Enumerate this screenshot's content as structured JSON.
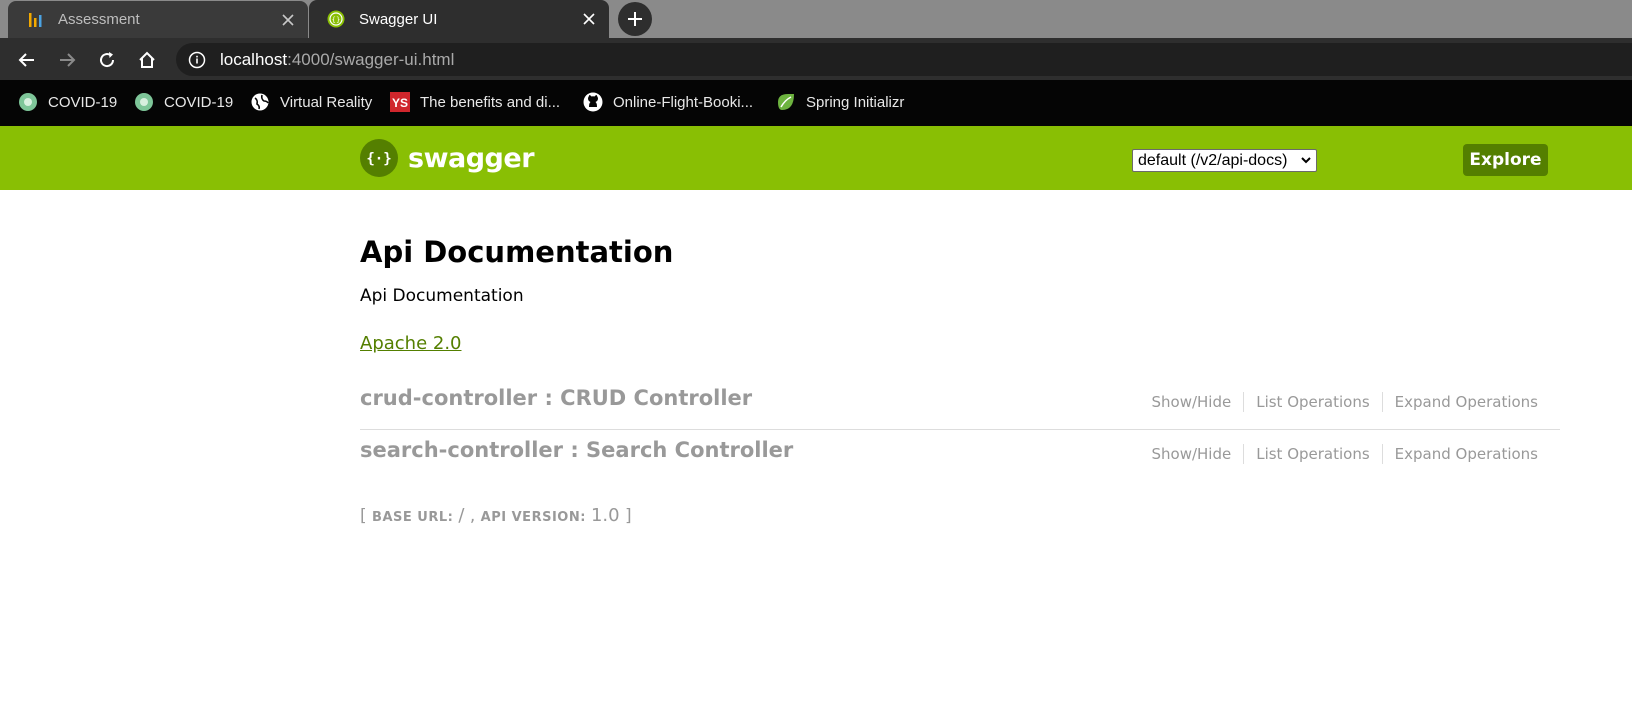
{
  "browser": {
    "tabs": [
      {
        "title": "Assessment",
        "active": false
      },
      {
        "title": "Swagger UI",
        "active": true
      }
    ],
    "address": {
      "host": "localhost",
      "rest": ":4000/swagger-ui.html"
    },
    "bookmarks": [
      {
        "label": "COVID-19",
        "icon": "covid-icon"
      },
      {
        "label": "COVID-19",
        "icon": "covid-icon"
      },
      {
        "label": "Virtual Reality",
        "icon": "globe-icon"
      },
      {
        "label": "The benefits and di...",
        "icon": "ys-icon"
      },
      {
        "label": "Online-Flight-Booki...",
        "icon": "github-icon"
      },
      {
        "label": "Spring Initializr",
        "icon": "spring-icon"
      }
    ]
  },
  "swagger": {
    "brand": "swagger",
    "spec_selected": "default (/v2/api-docs)",
    "explore_label": "Explore",
    "accent": "#89bf04",
    "accent_dark": "#547f00"
  },
  "api": {
    "title": "Api Documentation",
    "description": "Api Documentation",
    "license": "Apache 2.0"
  },
  "resources": [
    {
      "title": "crud-controller : CRUD Controller",
      "ops": [
        "Show/Hide",
        "List Operations",
        "Expand Operations"
      ]
    },
    {
      "title": "search-controller : Search Controller",
      "ops": [
        "Show/Hide",
        "List Operations",
        "Expand Operations"
      ]
    }
  ],
  "footer": {
    "open": "[",
    "base_url_label": "BASE URL",
    "base_url_value": "/",
    "sep": ",",
    "api_version_label": "API VERSION",
    "api_version_value": "1.0",
    "close": "]"
  }
}
